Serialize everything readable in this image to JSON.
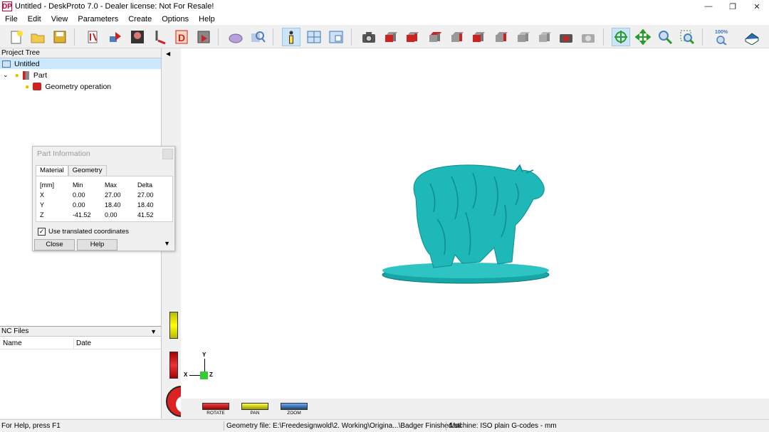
{
  "window": {
    "title": "Untitled - DeskProto 7.0 - Dealer license: Not For Resale!",
    "logo_text": "DP",
    "controls": [
      "minimize-icon",
      "restore-icon",
      "close-icon"
    ]
  },
  "menu": [
    "File",
    "Edit",
    "View",
    "Parameters",
    "Create",
    "Options",
    "Help"
  ],
  "toolbar": {
    "zoom_label": "100%",
    "buttons": [
      "new-file-icon",
      "open-folder-icon",
      "save-icon",
      "calculate-toolpath-icon",
      "send-icon",
      "simulate-icon",
      "tool-icon",
      "drawing-icon",
      "save-nc-icon",
      "part-icon",
      "search-icon",
      "info-icon",
      "layout-icon",
      "window-icon",
      "camera-icon",
      "cube-view-icon",
      "grid-icon",
      "move-icon",
      "zoom-icon",
      "zoom-window-icon",
      "zoom-100-icon",
      "book-icon"
    ]
  },
  "project_tree": {
    "header": "Project Tree",
    "items": [
      {
        "label": "Untitled",
        "selected": true
      },
      {
        "label": "Part",
        "expanded": true
      },
      {
        "label": "Geometry operation"
      }
    ]
  },
  "nc_files": {
    "header": "NC Files",
    "columns": [
      "Name",
      "Date"
    ]
  },
  "part_info": {
    "title": "Part Information",
    "tabs": [
      "Material",
      "Geometry"
    ],
    "active_tab": "Material",
    "headers": [
      "[mm]",
      "Min",
      "Max",
      "Delta"
    ],
    "rows": [
      [
        "X",
        "0.00",
        "27.00",
        "27.00"
      ],
      [
        "Y",
        "0.00",
        "18.40",
        "18.40"
      ],
      [
        "Z",
        "-41.52",
        "0.00",
        "41.52"
      ]
    ],
    "checkbox_label": "Use translated coordinates",
    "checkbox_checked": true,
    "close_label": "Close",
    "help_label": "Help"
  },
  "axes": {
    "x": "X",
    "y": "Y",
    "z": "Z"
  },
  "modes": {
    "rotate": "ROTATE",
    "pan": "PAN",
    "zoom": "ZOOM"
  },
  "status": {
    "help": "For Help, press F1",
    "geometry": "Geometry file: E:\\Freedesignwold\\2. Working\\Origina...\\Badger Finished.stl",
    "machine": "Machine: ISO plain G-codes - mm"
  },
  "colors": {
    "model": "#1fb8b8",
    "selection": "#cce8ff",
    "rotate_red": "#d22",
    "pan_yellow": "#ee0",
    "zoom_blue": "#3a8fd6"
  }
}
